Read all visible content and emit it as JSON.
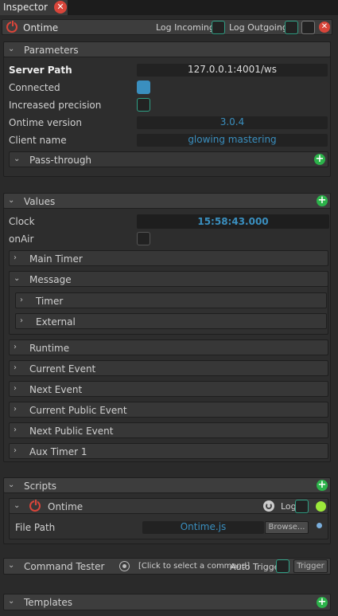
{
  "tab": {
    "title": "Inspector"
  },
  "module": {
    "name": "Ontime",
    "log_incoming": "Log Incoming",
    "log_outgoing": "Log Outgoing"
  },
  "parameters": {
    "title": "Parameters",
    "server_path_label": "Server Path",
    "server_path": "127.0.0.1:4001/ws",
    "connected_label": "Connected",
    "increased_precision_label": "Increased precision",
    "ontime_version_label": "Ontime version",
    "ontime_version": "3.0.4",
    "client_name_label": "Client name",
    "client_name": "glowing mastering",
    "passthrough": "Pass-through"
  },
  "values": {
    "title": "Values",
    "clock_label": "Clock",
    "clock": "15:58:43.000",
    "onair_label": "onAir",
    "main_timer": "Main Timer",
    "message": "Message",
    "message_children": [
      "Timer",
      "External"
    ],
    "groups": [
      "Runtime",
      "Current Event",
      "Next Event",
      "Current Public Event",
      "Next Public Event",
      "Aux Timer 1"
    ]
  },
  "scripts": {
    "title": "Scripts",
    "item_name": "Ontime",
    "log_label": "Log",
    "file_path_label": "File Path",
    "file_path": "Ontime.js",
    "browse": "Browse..."
  },
  "command_tester": {
    "title": "Command Tester",
    "placeholder": "[Click to select a command]",
    "auto_trigger": "Auto Trigger",
    "trigger": "Trigger"
  },
  "templates": {
    "title": "Templates"
  },
  "colors": {
    "accent_blue": "#3a8fbf",
    "green": "#2cb34a",
    "red": "#d8453a",
    "checkbox_border": "#2fa085"
  }
}
